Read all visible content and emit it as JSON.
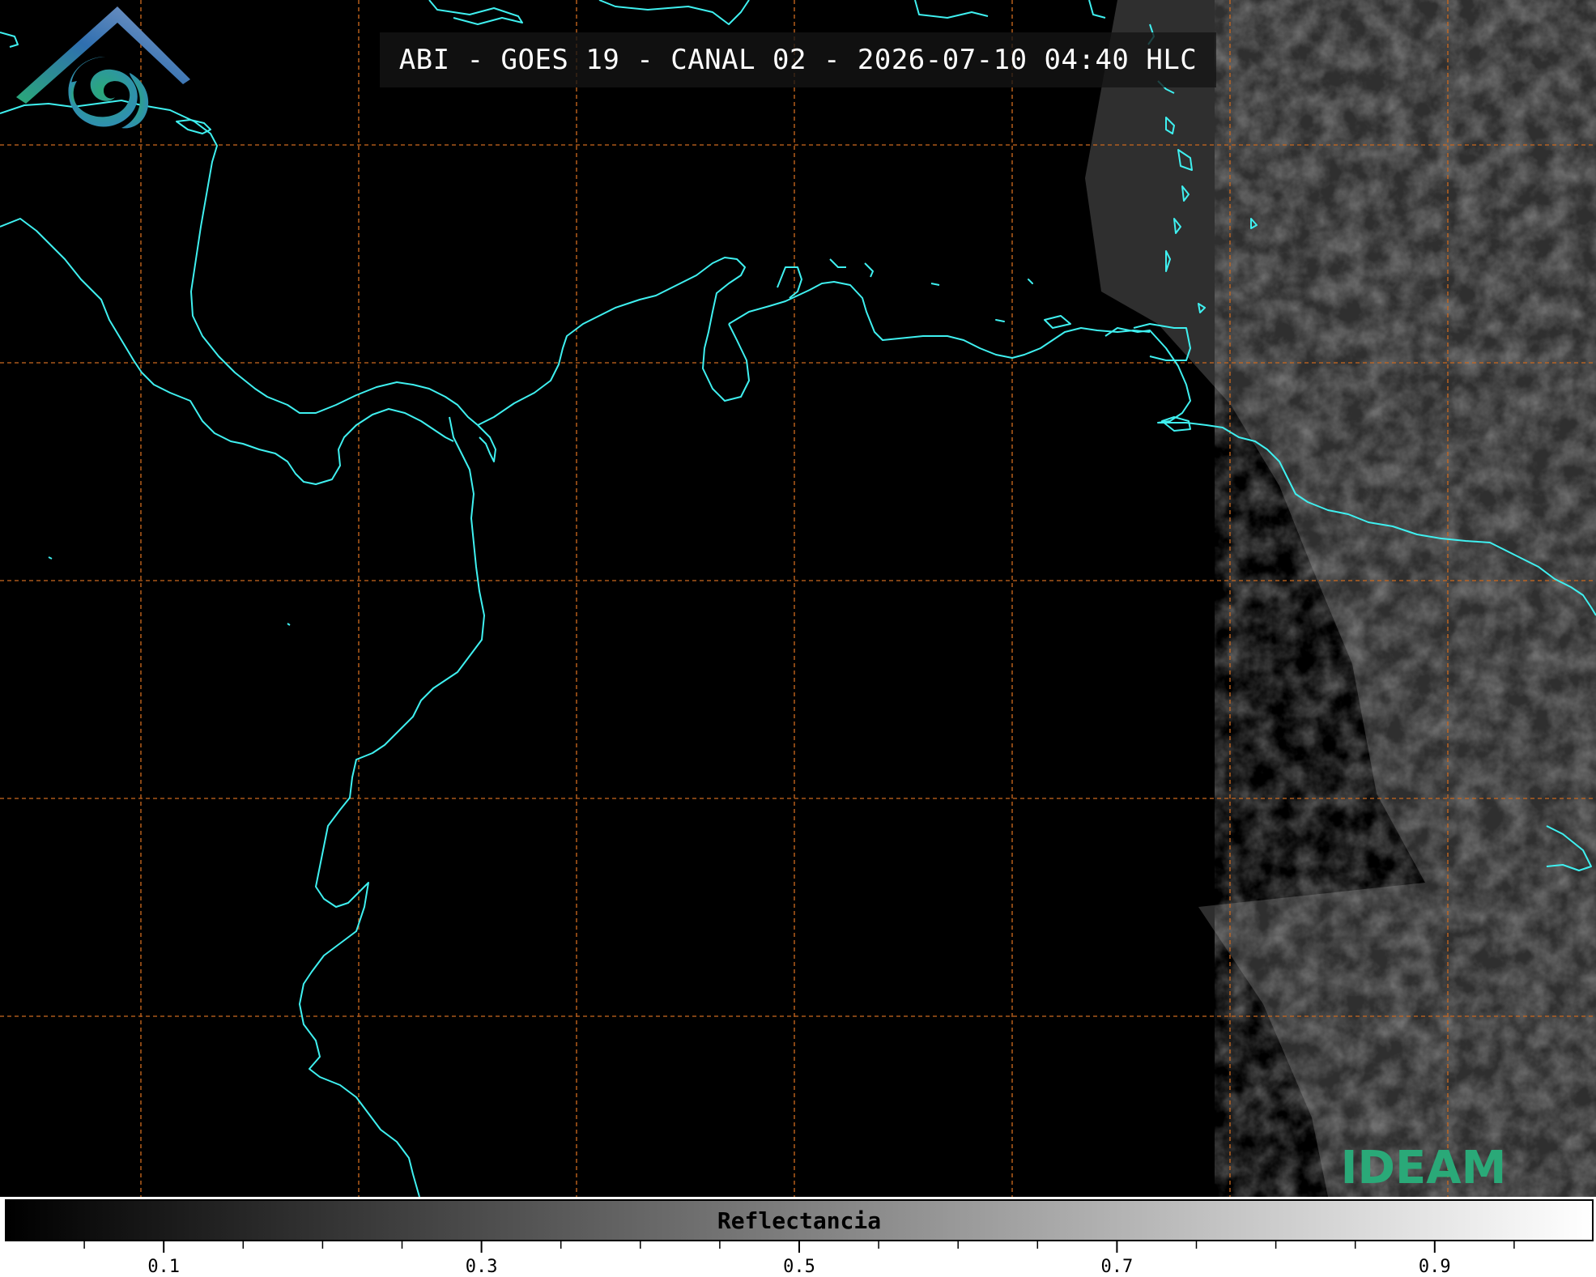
{
  "title": "ABI - GOES 19 - CANAL 02 - 2026-07-10 04:40 HLC",
  "logo": {
    "text": "IDEAM"
  },
  "colorbar": {
    "label": "Reflectancia",
    "range": [
      0.0,
      1.0
    ],
    "major_ticks": [
      {
        "value": 0.1,
        "label": "0.1"
      },
      {
        "value": 0.3,
        "label": "0.3"
      },
      {
        "value": 0.5,
        "label": "0.5"
      },
      {
        "value": 0.7,
        "label": "0.7"
      },
      {
        "value": 0.9,
        "label": "0.9"
      }
    ],
    "minor_ticks": [
      0.05,
      0.15,
      0.2,
      0.25,
      0.35,
      0.4,
      0.45,
      0.55,
      0.6,
      0.65,
      0.75,
      0.8,
      0.85,
      0.95
    ]
  },
  "colors": {
    "coastline": "#3ff0f0",
    "graticule": "#c8671e",
    "background": "#000000",
    "logo_green": "#2aa978",
    "logo_blue": "#2f6fb0"
  }
}
